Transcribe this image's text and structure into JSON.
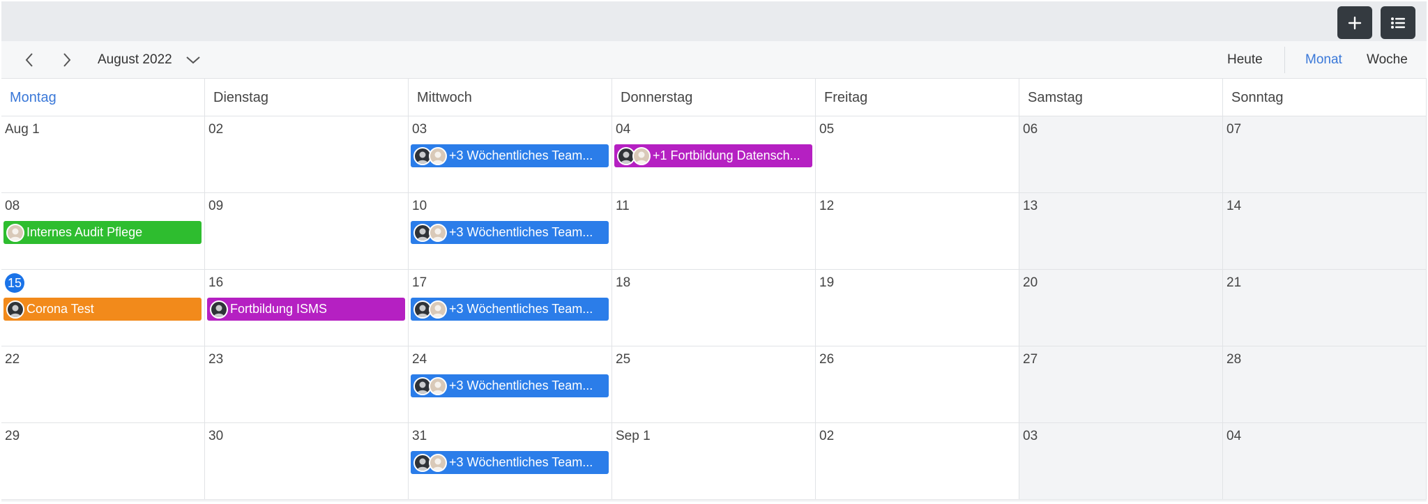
{
  "header": {
    "add_icon": "plus-icon",
    "list_icon": "list-icon"
  },
  "nav": {
    "month_label": "August 2022",
    "views": {
      "today": "Heute",
      "month": "Monat",
      "week": "Woche"
    },
    "active_view": "month"
  },
  "weekdays": [
    "Montag",
    "Dienstag",
    "Mittwoch",
    "Donnerstag",
    "Freitag",
    "Samstag",
    "Sonntag"
  ],
  "weeks": [
    [
      "Aug 1",
      "02",
      "03",
      "04",
      "05",
      "06",
      "07"
    ],
    [
      "08",
      "09",
      "10",
      "11",
      "12",
      "13",
      "14"
    ],
    [
      "15",
      "16",
      "17",
      "18",
      "19",
      "20",
      "21"
    ],
    [
      "22",
      "23",
      "24",
      "25",
      "26",
      "27",
      "28"
    ],
    [
      "29",
      "30",
      "31",
      "Sep 1",
      "02",
      "03",
      "04"
    ]
  ],
  "today": {
    "week": 2,
    "day": 0
  },
  "colors": {
    "blue": "#2b7de9",
    "magenta": "#b520c2",
    "green": "#2ebd2f",
    "orange": "#f28a1b",
    "accent": "#3a78d8",
    "today": "#1a73e8"
  },
  "events": [
    {
      "week": 0,
      "day": 2,
      "color": "#2b7de9",
      "avatars": [
        "dark",
        "light"
      ],
      "text": "+3 Wöchentliches Team..."
    },
    {
      "week": 0,
      "day": 3,
      "color": "#b520c2",
      "avatars": [
        "dark",
        "light"
      ],
      "text": "+1 Fortbildung Datensch..."
    },
    {
      "week": 1,
      "day": 0,
      "color": "#2ebd2f",
      "avatars": [
        "light"
      ],
      "text": "Internes Audit Pflege"
    },
    {
      "week": 1,
      "day": 2,
      "color": "#2b7de9",
      "avatars": [
        "dark",
        "light"
      ],
      "text": "+3 Wöchentliches Team..."
    },
    {
      "week": 2,
      "day": 0,
      "color": "#f28a1b",
      "avatars": [
        "dark"
      ],
      "text": "Corona Test"
    },
    {
      "week": 2,
      "day": 1,
      "color": "#b520c2",
      "avatars": [
        "dark"
      ],
      "text": "Fortbildung ISMS"
    },
    {
      "week": 2,
      "day": 2,
      "color": "#2b7de9",
      "avatars": [
        "dark",
        "light"
      ],
      "text": "+3 Wöchentliches Team..."
    },
    {
      "week": 3,
      "day": 2,
      "color": "#2b7de9",
      "avatars": [
        "dark",
        "light"
      ],
      "text": "+3 Wöchentliches Team..."
    },
    {
      "week": 4,
      "day": 2,
      "color": "#2b7de9",
      "avatars": [
        "dark",
        "light"
      ],
      "text": "+3 Wöchentliches Team..."
    }
  ]
}
